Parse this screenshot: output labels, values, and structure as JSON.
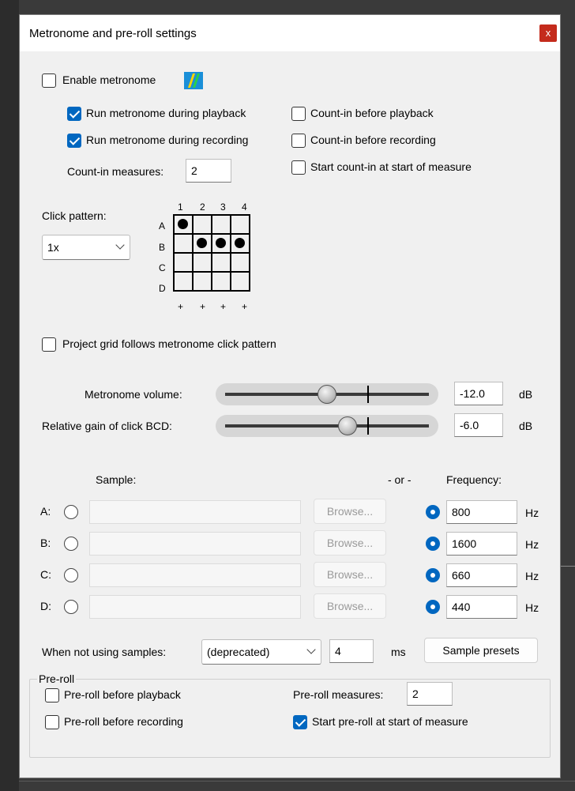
{
  "dialog": {
    "title": "Metronome and pre-roll settings",
    "close_label": "x"
  },
  "metronome": {
    "enable": {
      "label": "Enable metronome",
      "checked": false
    },
    "run_playback": {
      "label": "Run metronome during playback",
      "checked": true
    },
    "run_recording": {
      "label": "Run metronome during recording",
      "checked": true
    },
    "countin_playback": {
      "label": "Count-in before playback",
      "checked": false
    },
    "countin_recording": {
      "label": "Count-in before recording",
      "checked": false
    },
    "countin_start_measure": {
      "label": "Start count-in at start of measure",
      "checked": false
    },
    "countin_measures_label": "Count-in measures:",
    "countin_measures_value": "2"
  },
  "click_pattern": {
    "label": "Click pattern:",
    "selected": "1x",
    "columns": [
      "1",
      "2",
      "3",
      "4"
    ],
    "rows": [
      "A",
      "B",
      "C",
      "D"
    ],
    "plus": [
      "+",
      "+",
      "+",
      "+"
    ],
    "cells": [
      [
        1,
        0,
        0,
        0
      ],
      [
        0,
        1,
        1,
        1
      ],
      [
        0,
        0,
        0,
        0
      ],
      [
        0,
        0,
        0,
        0
      ]
    ]
  },
  "project_grid": {
    "label": "Project grid follows metronome click pattern",
    "checked": false
  },
  "volume": {
    "label": "Metronome volume:",
    "value": "-12.0",
    "unit": "dB",
    "level": 0.5,
    "center_mark": 0.72
  },
  "gain": {
    "label": "Relative gain of click BCD:",
    "value": "-6.0",
    "unit": "dB",
    "level": 0.6,
    "center_mark": 0.72
  },
  "samples": {
    "sample_header": "Sample:",
    "or_label": "- or -",
    "frequency_header": "Frequency:",
    "browse_label": "Browse...",
    "hz_label": "Hz",
    "rows": [
      {
        "label": "A:",
        "frequency": "800"
      },
      {
        "label": "B:",
        "frequency": "1600"
      },
      {
        "label": "C:",
        "frequency": "660"
      },
      {
        "label": "D:",
        "frequency": "440"
      }
    ]
  },
  "not_using_samples": {
    "label": "When not using samples:",
    "mode": "(deprecated)",
    "ms_value": "4",
    "ms_label": "ms",
    "presets_label": "Sample presets"
  },
  "preroll": {
    "group_label": "Pre-roll",
    "before_playback": {
      "label": "Pre-roll before playback",
      "checked": false
    },
    "before_recording": {
      "label": "Pre-roll before recording",
      "checked": false
    },
    "measures_label": "Pre-roll measures:",
    "measures_value": "2",
    "start_at_measure": {
      "label": "Start pre-roll at start of measure",
      "checked": true
    }
  },
  "colors": {
    "accent": "#0067c0",
    "close": "#c42b1c",
    "dialog_bg": "#f0f0f0"
  }
}
